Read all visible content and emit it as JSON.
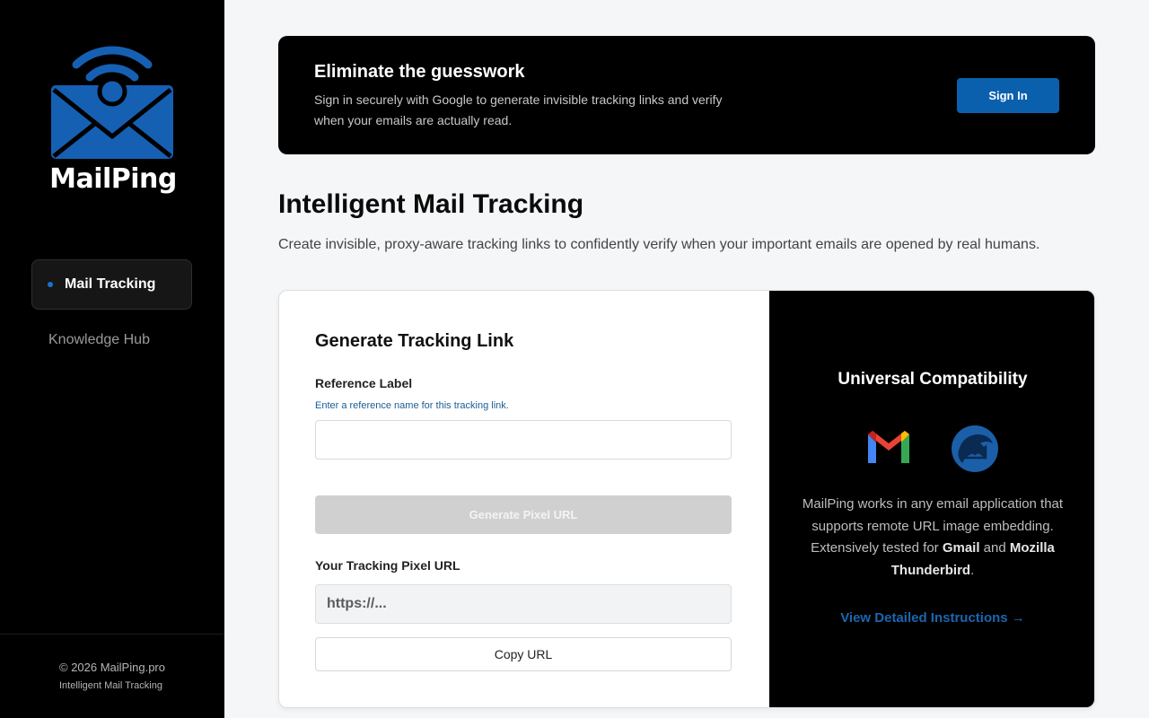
{
  "brand": {
    "name": "MailPing",
    "accent": "#0b60ad"
  },
  "sidebar": {
    "items": [
      {
        "label": "Mail Tracking",
        "active": true,
        "icon": "bullet-dot"
      },
      {
        "label": "Knowledge Hub",
        "active": false
      }
    ],
    "footer": {
      "copyright": "© 2026 MailPing.pro",
      "tagline": "Intelligent Mail Tracking"
    }
  },
  "banner": {
    "title": "Eliminate the guesswork",
    "text": "Sign in securely with Google to generate invisible tracking links and verify when your emails are actually read.",
    "signin_label": "Sign In"
  },
  "main": {
    "title": "Intelligent Mail Tracking",
    "subtitle": "Create invisible, proxy-aware tracking links to confidently verify when your important emails are opened by real humans."
  },
  "generator": {
    "title": "Generate Tracking Link",
    "reference_label": "Reference Label",
    "reference_hint": "Enter a reference name for this tracking link.",
    "reference_value": "",
    "generate_label": "Generate Pixel URL",
    "url_label": "Your Tracking Pixel URL",
    "url_placeholder": "https://...",
    "copy_label": "Copy URL"
  },
  "compat": {
    "title": "Universal Compatibility",
    "icons": [
      "gmail-icon",
      "thunderbird-icon"
    ],
    "desc_part1": "MailPing works in any email application that supports remote URL image embedding. Extensively tested for ",
    "desc_gmail": "Gmail",
    "desc_and": " and ",
    "desc_thunderbird": "Mozilla Thunderbird",
    "desc_end": ".",
    "instructions_label": "View Detailed Instructions →"
  }
}
